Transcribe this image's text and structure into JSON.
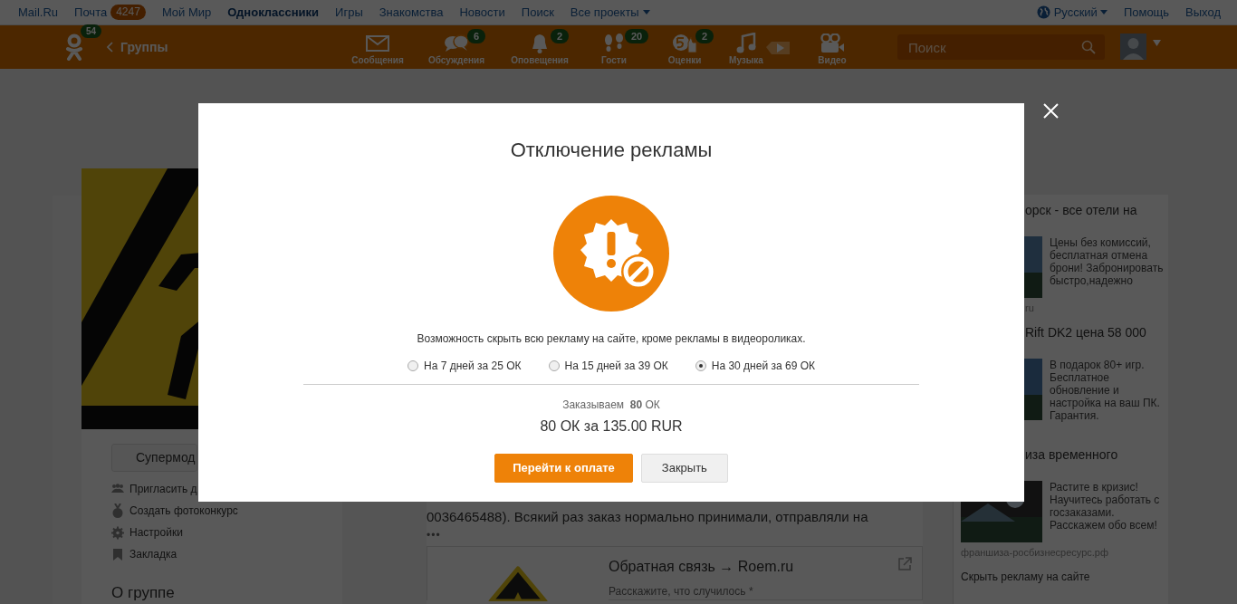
{
  "topbar": {
    "links": [
      {
        "label": "Mail.Ru",
        "bold": false
      },
      {
        "label": "Почта",
        "bold": false,
        "badge": "4247"
      },
      {
        "label": "Мой Мир",
        "bold": false
      },
      {
        "label": "Одноклассники",
        "bold": true
      },
      {
        "label": "Игры",
        "bold": false
      },
      {
        "label": "Знакомства",
        "bold": false
      },
      {
        "label": "Новости",
        "bold": false
      },
      {
        "label": "Поиск",
        "bold": false
      },
      {
        "label": "Все проекты",
        "bold": false,
        "dropdown": true
      }
    ],
    "language": "Русский",
    "right_links": [
      "Помощь",
      "Выход"
    ]
  },
  "header": {
    "logo_badge": "54",
    "back": "Группы",
    "nav": [
      {
        "kind": "envelope",
        "label": "Сообщения"
      },
      {
        "kind": "chat",
        "label": "Обсуждения",
        "badge": "6"
      },
      {
        "kind": "bell",
        "label": "Оповещения",
        "badge": "2"
      },
      {
        "kind": "feet",
        "label": "Гости",
        "badge": "20"
      },
      {
        "kind": "rating",
        "label": "Оценки",
        "badge": "2"
      },
      {
        "kind": "music",
        "label": "Музыка"
      },
      {
        "kind": "video",
        "label": "Видео"
      }
    ],
    "search": {
      "placeholder": "Поиск"
    }
  },
  "left": {
    "button": "Супермод",
    "menu": [
      {
        "kind": "people",
        "label": "Пригласить д"
      },
      {
        "kind": "medal",
        "label": "Создать фотоконкурс"
      },
      {
        "kind": "gear",
        "label": "Настройки"
      },
      {
        "kind": "bookmark",
        "label": "Закладка"
      }
    ],
    "heading": "О группе"
  },
  "center": {
    "text": "0036465488). Всякий раз заказ нормально принимали, отправляли на",
    "more": "•••",
    "card": {
      "title": "Обратная связь → Roem.ru",
      "hint": "Расскажите, что случилось *"
    }
  },
  "ads": [
    {
      "title": "орск - все отели на",
      "text": "Цены без комиссий, бесплатная отмена брони! Забронировать быстро,надежно",
      "domain": "ru"
    },
    {
      "title": "Rift DK2 цена 58 000",
      "text": "В подарок 80+ игр. Бесплатное обновление и настройка на ваш ПК. Гарантия."
    },
    {
      "title": "иза временного",
      "text": "Растите в кризис! Научитесь работать с госзаказами. Расскажем обо всем!",
      "domain": "франшиза-росбизнесресурс.рф"
    }
  ],
  "hide_ads": "Скрыть рекламу на сайте",
  "modal": {
    "title": "Отключение рекламы",
    "description": "Возможность скрыть всю рекламу на сайте, кроме рекламы в видеороликах.",
    "options": [
      {
        "label": "На 7 дней за 25 ОК",
        "selected": false
      },
      {
        "label": "На 15 дней за 39 ОК",
        "selected": false
      },
      {
        "label": "На 30 дней за 69 ОК",
        "selected": true
      }
    ],
    "order": "Заказываем  **80** ОК",
    "total": "80 ОК за 135.00 RUR",
    "buttons": [
      {
        "kind": "primary",
        "label": "Перейти к оплате"
      },
      {
        "kind": "secondary",
        "label": "Закрыть"
      }
    ]
  }
}
